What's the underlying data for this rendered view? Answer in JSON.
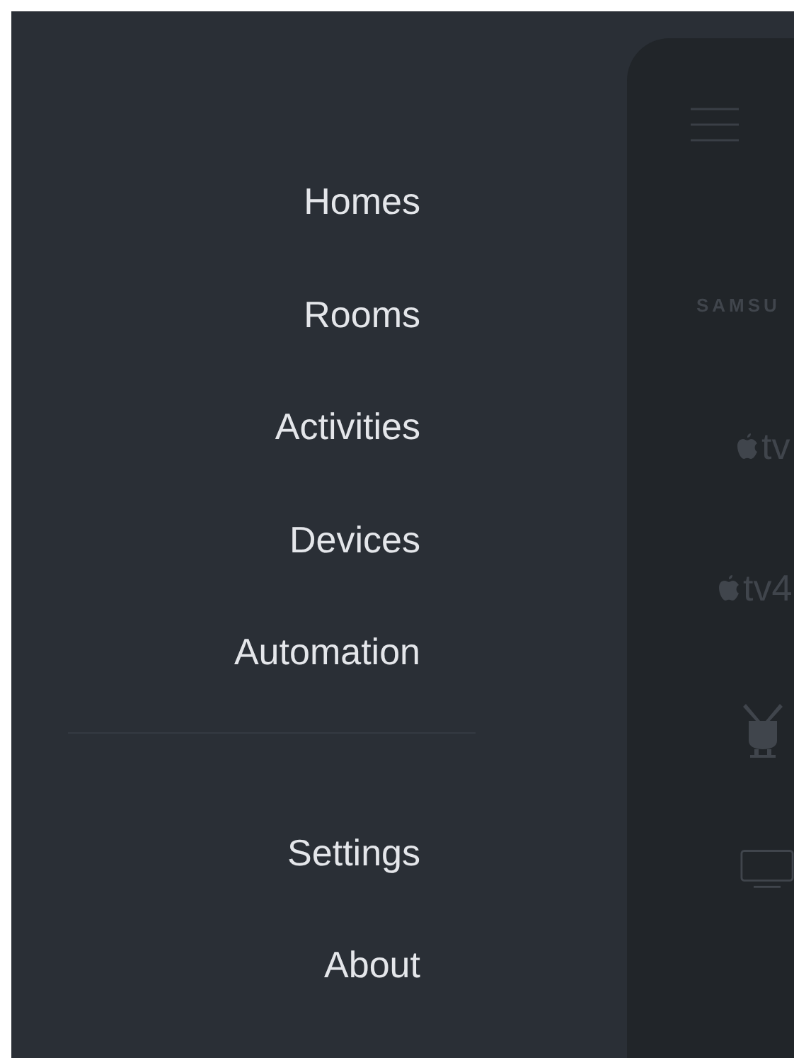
{
  "menu": {
    "items": [
      {
        "label": "Homes"
      },
      {
        "label": "Rooms"
      },
      {
        "label": "Activities"
      },
      {
        "label": "Devices"
      },
      {
        "label": "Automation"
      }
    ],
    "footer_items": [
      {
        "label": "Settings"
      },
      {
        "label": "About"
      }
    ]
  },
  "panel": {
    "devices": [
      {
        "kind": "brand",
        "label": "SAMSU"
      },
      {
        "kind": "apple",
        "label": "tv"
      },
      {
        "kind": "apple",
        "label": "tv4"
      },
      {
        "kind": "tivo"
      },
      {
        "kind": "monitor"
      }
    ]
  }
}
